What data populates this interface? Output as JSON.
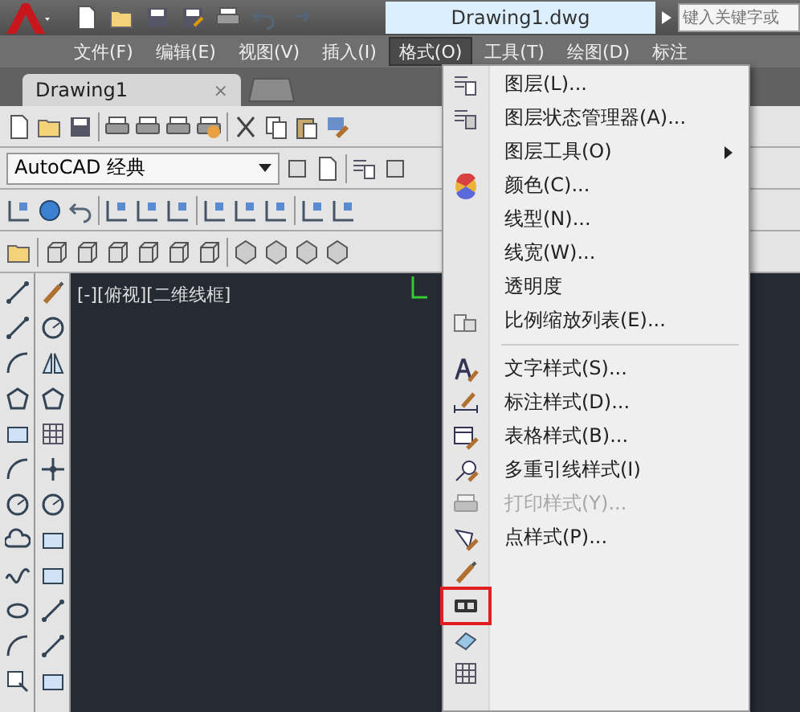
{
  "title_bar": {
    "title": "Drawing1.dwg",
    "search": {
      "placeholder": "键入关键字或"
    }
  },
  "menu_bar": [
    {
      "label": "文件(F)",
      "selected": false
    },
    {
      "label": "编辑(E)",
      "selected": false
    },
    {
      "label": "视图(V)",
      "selected": false
    },
    {
      "label": "插入(I)",
      "selected": false
    },
    {
      "label": "格式(O)",
      "selected": true
    },
    {
      "label": "工具(T)",
      "selected": false
    },
    {
      "label": "绘图(D)",
      "selected": false
    },
    {
      "label": "标注",
      "selected": false
    }
  ],
  "tabs": [
    {
      "label": "Drawing1",
      "close": "×",
      "selected": true
    }
  ],
  "workspace": {
    "value": "AutoCAD 经典"
  },
  "viewport": {
    "label": "[-][俯视][二维线框]"
  },
  "format_menu": {
    "items": [
      {
        "kind": "item",
        "label": "图层(L)...",
        "disabled": false
      },
      {
        "kind": "item",
        "label": "图层状态管理器(A)...",
        "disabled": false
      },
      {
        "kind": "submenu",
        "label": "图层工具(O)",
        "disabled": false
      },
      {
        "kind": "item",
        "label": "颜色(C)...",
        "disabled": false
      },
      {
        "kind": "item",
        "label": "线型(N)...",
        "disabled": false
      },
      {
        "kind": "item",
        "label": "线宽(W)...",
        "disabled": false
      },
      {
        "kind": "item",
        "label": "透明度",
        "disabled": false
      },
      {
        "kind": "item",
        "label": "比例缩放列表(E)...",
        "disabled": false
      },
      {
        "kind": "separator"
      },
      {
        "kind": "item",
        "label": "文字样式(S)...",
        "disabled": false
      },
      {
        "kind": "item",
        "label": "标注样式(D)...",
        "disabled": false
      },
      {
        "kind": "item",
        "label": "表格样式(B)...",
        "disabled": false
      },
      {
        "kind": "item",
        "label": "多重引线样式(I)",
        "disabled": false
      },
      {
        "kind": "item",
        "label": "打印样式(Y)...",
        "disabled": true
      },
      {
        "kind": "item",
        "label": "点样式(P)...",
        "disabled": false
      },
      {
        "kind": "icon_only",
        "highlighted": false
      },
      {
        "kind": "icon_only",
        "highlighted": true
      },
      {
        "kind": "icon_only",
        "highlighted": false
      },
      {
        "kind": "icon_only",
        "highlighted": false
      }
    ]
  }
}
